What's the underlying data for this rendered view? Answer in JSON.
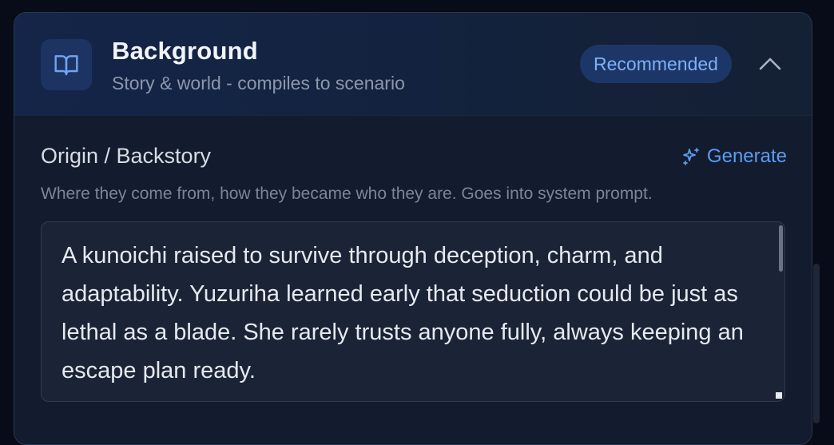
{
  "section": {
    "icon": "book-open-icon",
    "title": "Background",
    "subtitle": "Story & world - compiles to scenario",
    "badge": "Recommended",
    "collapse_icon": "chevron-up-icon"
  },
  "field": {
    "label": "Origin / Backstory",
    "generate_label": "Generate",
    "generate_icon": "sparkles-icon",
    "hint": "Where they come from, how they became who they are. Goes into system prompt.",
    "value": "A kunoichi raised to survive through deception, charm, and adaptability. Yuzuriha learned early that seduction could be just as lethal as a blade. She rarely trusts anyone fully, always keeping an escape plan ready."
  },
  "colors": {
    "page_bg": "#070c18",
    "card_bg": "#131c2e",
    "header_bg": "#142549",
    "accent": "#5c9bf2",
    "badge_bg": "#1c3667",
    "badge_text": "#7fb0f6"
  }
}
